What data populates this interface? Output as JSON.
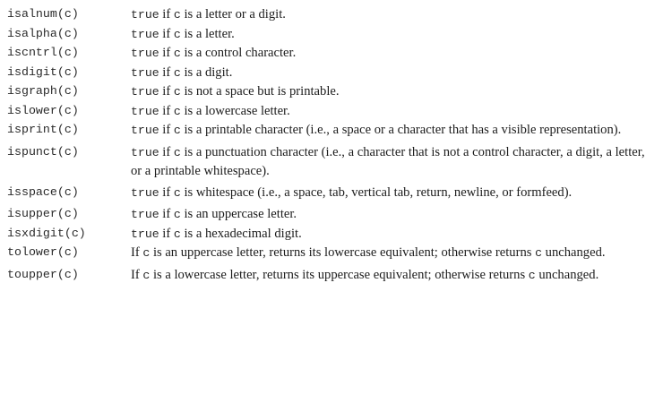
{
  "rows": [
    {
      "fn": "isalnum(c)",
      "desc": [
        {
          "code": "true"
        },
        {
          "text": " if "
        },
        {
          "code": "c"
        },
        {
          "text": " is a letter or a digit."
        }
      ]
    },
    {
      "fn": "isalpha(c)",
      "desc": [
        {
          "code": "true"
        },
        {
          "text": " if "
        },
        {
          "code": "c"
        },
        {
          "text": " is a letter."
        }
      ]
    },
    {
      "fn": "iscntrl(c)",
      "desc": [
        {
          "code": "true"
        },
        {
          "text": " if "
        },
        {
          "code": "c"
        },
        {
          "text": " is a control character."
        }
      ]
    },
    {
      "fn": "isdigit(c)",
      "desc": [
        {
          "code": "true"
        },
        {
          "text": " if "
        },
        {
          "code": "c"
        },
        {
          "text": " is a digit."
        }
      ]
    },
    {
      "fn": "isgraph(c)",
      "desc": [
        {
          "code": "true"
        },
        {
          "text": " if "
        },
        {
          "code": "c"
        },
        {
          "text": " is not a space but is printable."
        }
      ]
    },
    {
      "fn": "islower(c)",
      "desc": [
        {
          "code": "true"
        },
        {
          "text": " if "
        },
        {
          "code": "c"
        },
        {
          "text": " is a lowercase letter."
        }
      ]
    },
    {
      "fn": "isprint(c)",
      "desc": [
        {
          "code": "true"
        },
        {
          "text": " if "
        },
        {
          "code": "c"
        },
        {
          "text": " is a printable character (i.e., a space or a character that has a visible representation)."
        }
      ]
    },
    {
      "fn": "ispunct(c)",
      "desc": [
        {
          "code": "true"
        },
        {
          "text": " if "
        },
        {
          "code": "c"
        },
        {
          "text": " is a punctuation character (i.e., a character that is not a control character, a digit, a letter, or a printable whitespace)."
        }
      ]
    },
    {
      "fn": "isspace(c)",
      "desc": [
        {
          "code": "true"
        },
        {
          "text": " if "
        },
        {
          "code": "c"
        },
        {
          "text": " is whitespace (i.e., a space, tab, vertical tab, return, newline, or formfeed)."
        }
      ]
    },
    {
      "fn": "isupper(c)",
      "desc": [
        {
          "code": "true"
        },
        {
          "text": " if "
        },
        {
          "code": "c"
        },
        {
          "text": " is an uppercase letter."
        }
      ]
    },
    {
      "fn": "isxdigit(c)",
      "desc": [
        {
          "code": "true"
        },
        {
          "text": " if "
        },
        {
          "code": "c"
        },
        {
          "text": " is a hexadecimal digit."
        }
      ]
    },
    {
      "fn": "tolower(c)",
      "desc": [
        {
          "text": "If "
        },
        {
          "code": "c"
        },
        {
          "text": " is an uppercase letter, returns its lowercase equivalent; otherwise returns "
        },
        {
          "code": "c"
        },
        {
          "text": " unchanged."
        }
      ]
    },
    {
      "fn": "toupper(c)",
      "desc": [
        {
          "text": "If "
        },
        {
          "code": "c"
        },
        {
          "text": " is a lowercase letter, returns its uppercase equivalent; otherwise returns "
        },
        {
          "code": "c"
        },
        {
          "text": " unchanged."
        }
      ]
    }
  ]
}
